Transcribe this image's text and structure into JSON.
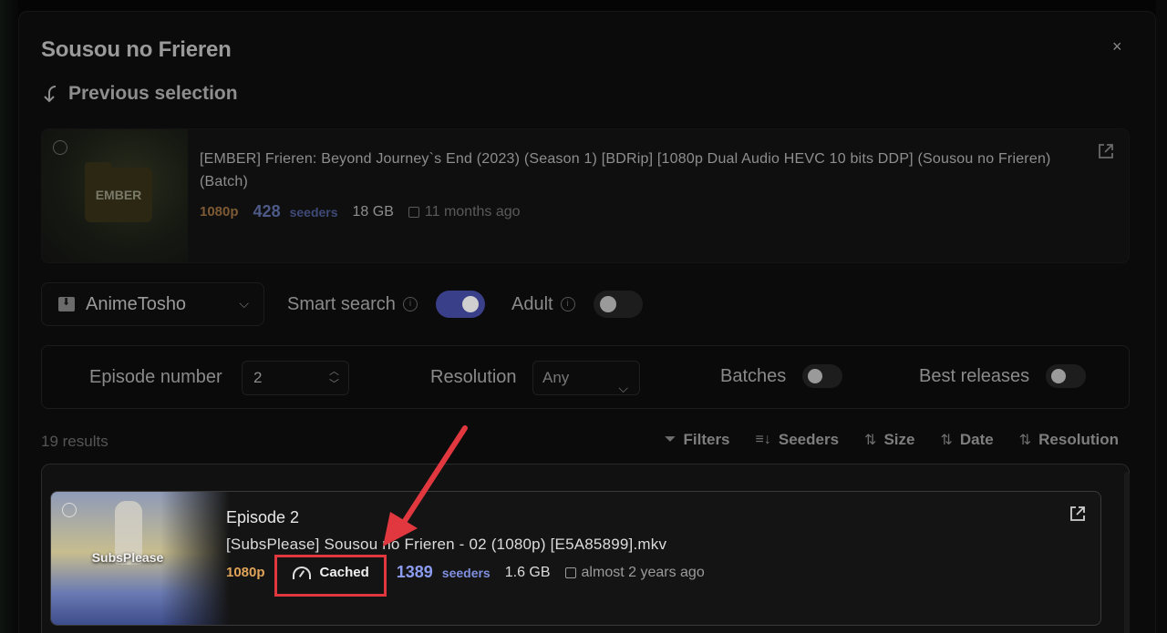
{
  "modal": {
    "title": "Sousou no Frieren",
    "close_icon": "×",
    "previous_label": "Previous selection"
  },
  "previous": {
    "thumb_label": "EMBER",
    "title": "[EMBER] Frieren: Beyond Journey`s End (2023) (Season 1) [BDRip] [1080p Dual Audio HEVC 10 bits DDP] (Sousou no Frieren) (Batch)",
    "resolution": "1080p",
    "seeders": "428",
    "seeders_label": "seeders",
    "size": "18 GB",
    "date": "11 months ago"
  },
  "controls": {
    "provider": "AnimeTosho",
    "smart_search_label": "Smart search",
    "smart_search_on": true,
    "adult_label": "Adult",
    "adult_on": false
  },
  "filters": {
    "episode_label": "Episode number",
    "episode_value": "2",
    "resolution_label": "Resolution",
    "resolution_value": "Any",
    "batches_label": "Batches",
    "best_releases_label": "Best releases"
  },
  "results": {
    "count": "19 results",
    "sort": {
      "filters": "Filters",
      "seeders": "Seeders",
      "size": "Size",
      "date": "Date",
      "resolution": "Resolution"
    }
  },
  "result_item": {
    "thumb_label": "SubsPlease",
    "episode": "Episode 2",
    "file_name": "[SubsPlease] Sousou no Frieren - 02 (1080p) [E5A85899].mkv",
    "resolution": "1080p",
    "cached": "Cached",
    "seeders": "1389",
    "seeders_label": "seeders",
    "size": "1.6 GB",
    "date": "almost 2 years ago"
  },
  "colors": {
    "accent_annotation": "#e0383e",
    "toggle_on": "#3a3f8a",
    "resolution": "#e0a45a",
    "seeders": "#8c9cf0"
  }
}
